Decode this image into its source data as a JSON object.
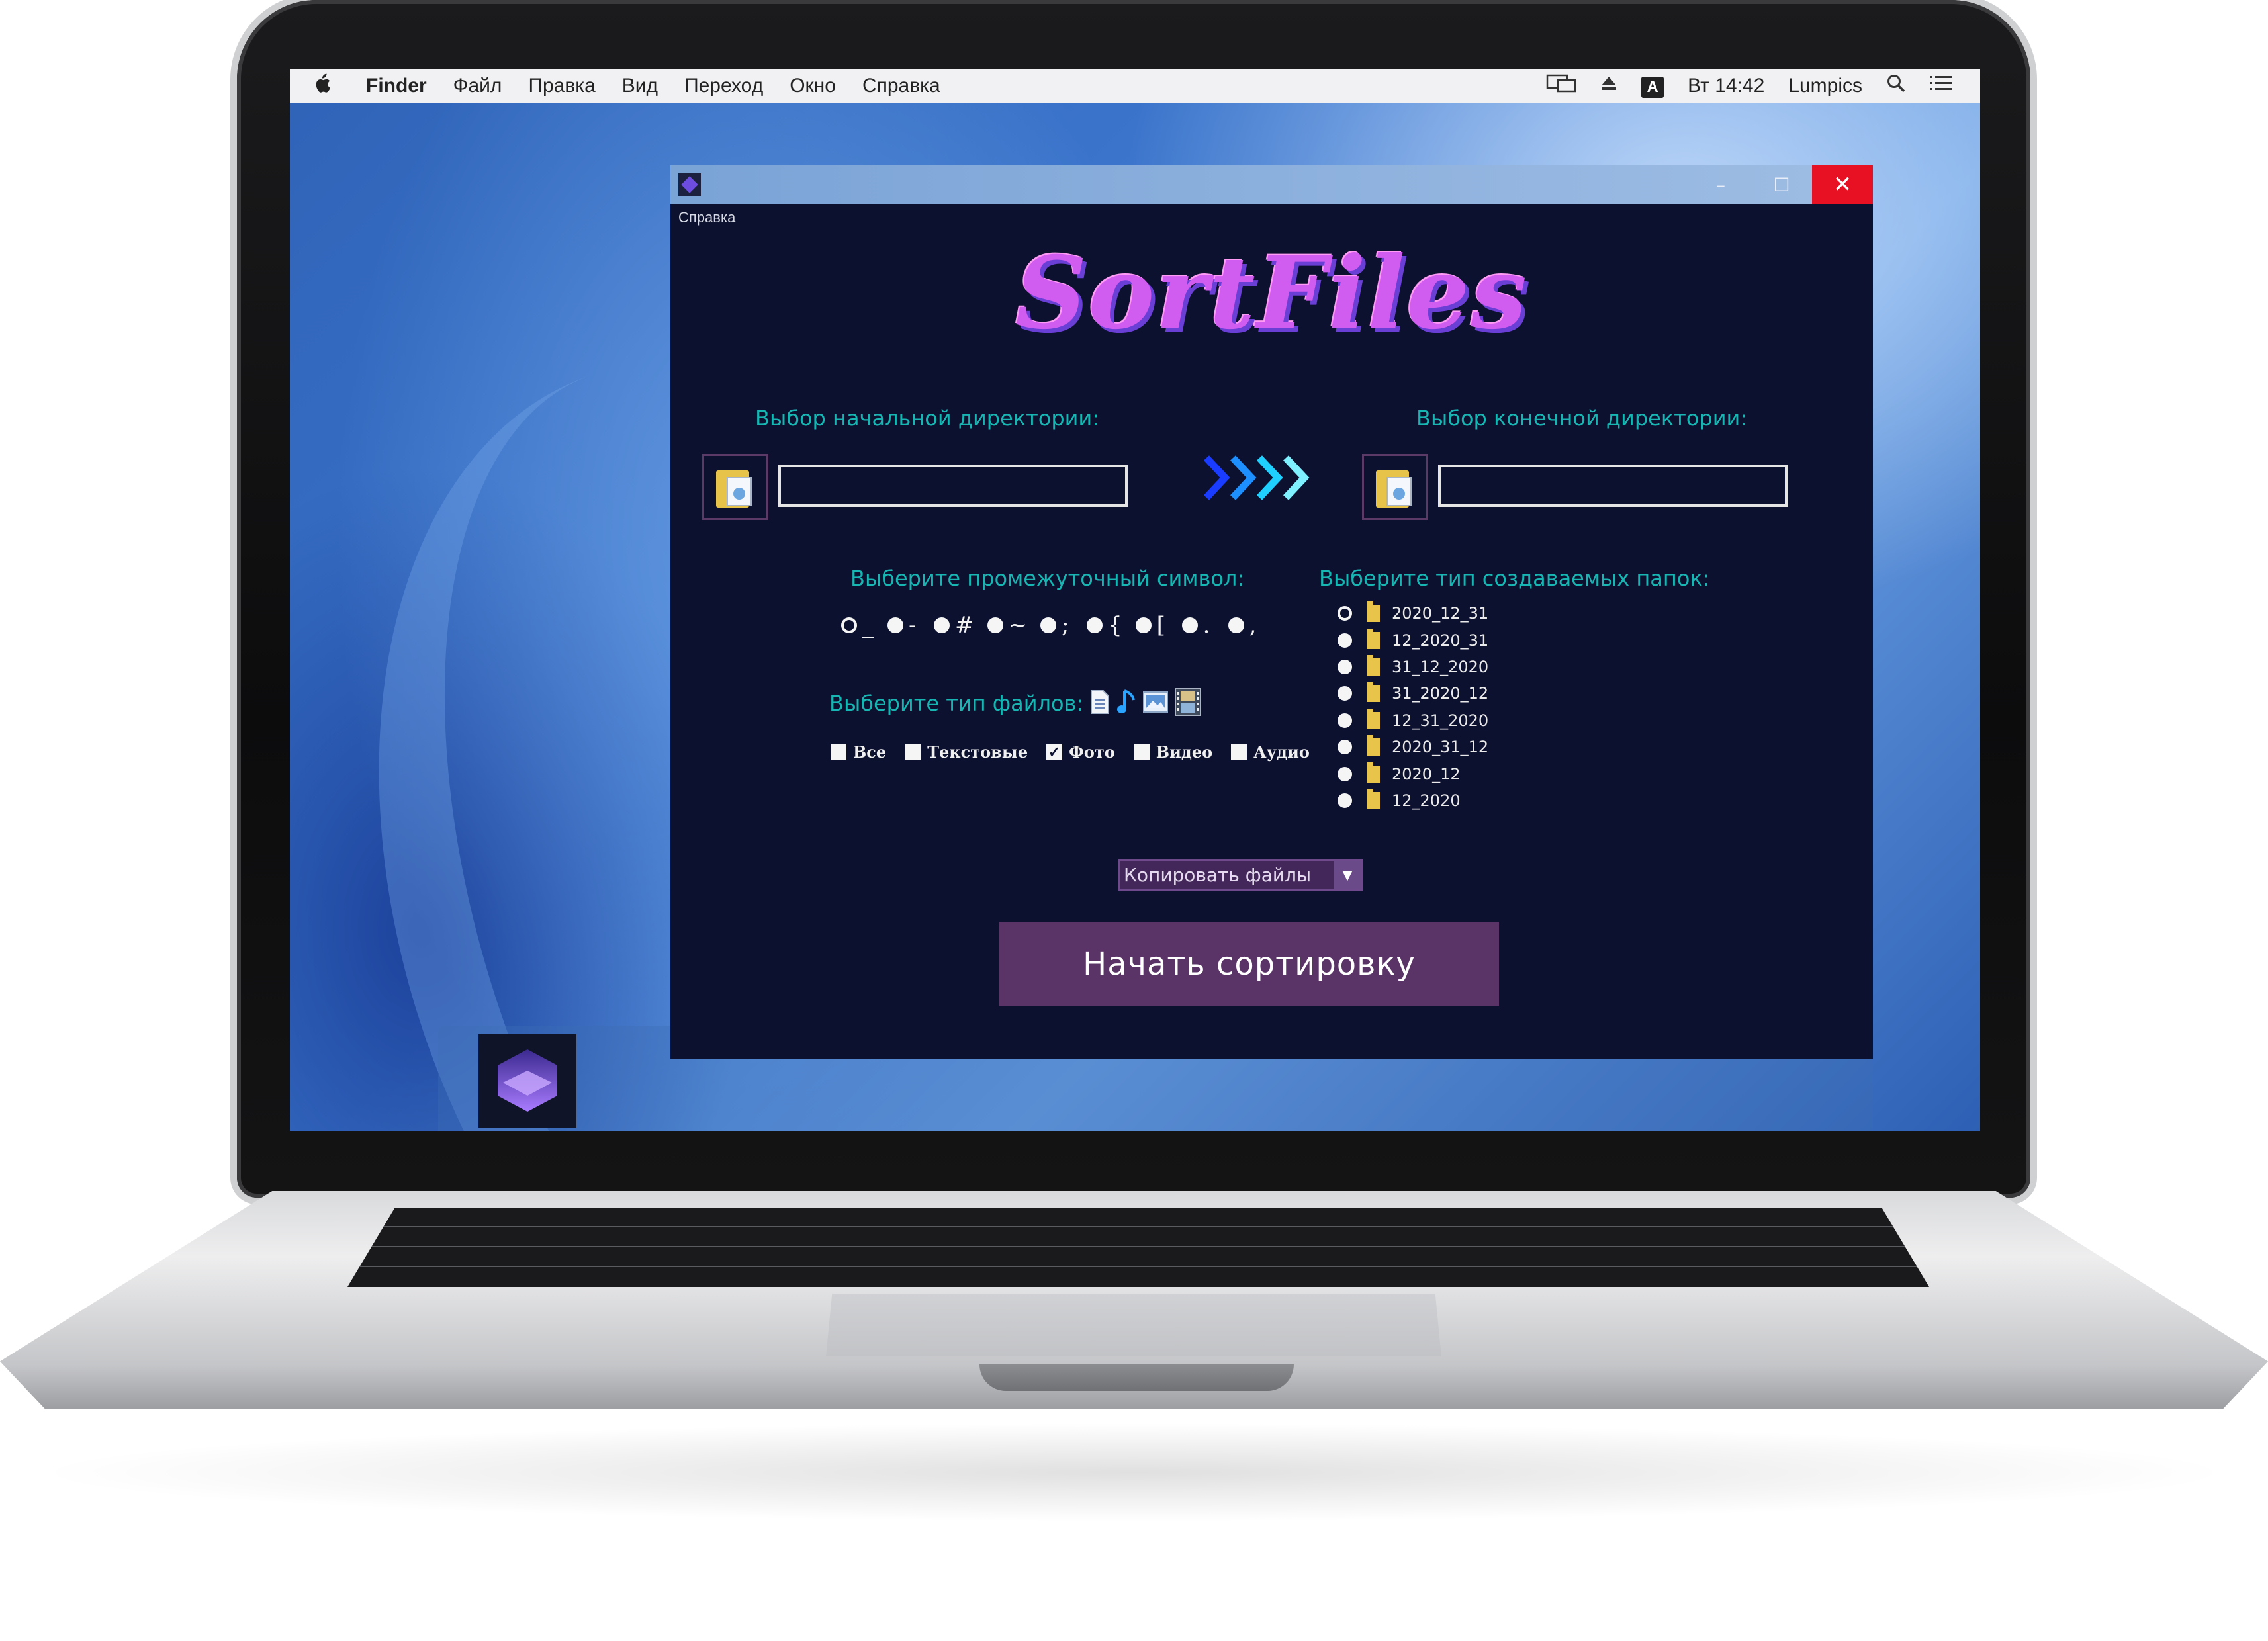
{
  "menubar": {
    "apple": "",
    "items": [
      "Finder",
      "Файл",
      "Правка",
      "Вид",
      "Переход",
      "Окно",
      "Справка"
    ],
    "time": "Вт 14:42",
    "user": "Lumpics",
    "input_badge": "A"
  },
  "window": {
    "menu_help": "Справка",
    "controls": {
      "minimize": "–",
      "maximize": "☐",
      "close": "✕"
    },
    "logo_text": "SortFiles",
    "source": {
      "label": "Выбор начальной директории:",
      "value": ""
    },
    "destination": {
      "label": "Выбор конечной директории:",
      "value": ""
    },
    "separator": {
      "label": "Выберите промежуточный символ:",
      "options": [
        "_",
        "-",
        "#",
        "~",
        ";",
        "{",
        "[",
        ".",
        ","
      ],
      "selected_index": 0
    },
    "file_types": {
      "label": "Выберите тип файлов:",
      "options": [
        {
          "label": "Все",
          "checked": false
        },
        {
          "label": "Текстовые",
          "checked": false
        },
        {
          "label": "Фото",
          "checked": true
        },
        {
          "label": "Видео",
          "checked": false
        },
        {
          "label": "Аудио",
          "checked": false
        }
      ]
    },
    "folder_format": {
      "label": "Выберите тип создаваемых папок:",
      "options": [
        "2020_12_31",
        "12_2020_31",
        "31_12_2020",
        "31_2020_12",
        "12_31_2020",
        "2020_31_12",
        "2020_12",
        "12_2020"
      ],
      "selected_index": 0
    },
    "mode_select": {
      "value": "Копировать файлы"
    },
    "start_button": "Начать сортировку"
  },
  "colors": {
    "window_bg": "#0d1130",
    "label_cyan": "#18b6b3",
    "button_purple": "#5a3467",
    "logo_pink": "#d15cf0",
    "close_red": "#e81123"
  },
  "icons": [
    "apple-logo-icon",
    "display-icon",
    "eject-icon",
    "search-icon",
    "list-icon",
    "folder-icon",
    "arrows-right-icon",
    "document-icon",
    "music-note-icon",
    "image-icon",
    "film-icon",
    "cube-app-icon"
  ]
}
